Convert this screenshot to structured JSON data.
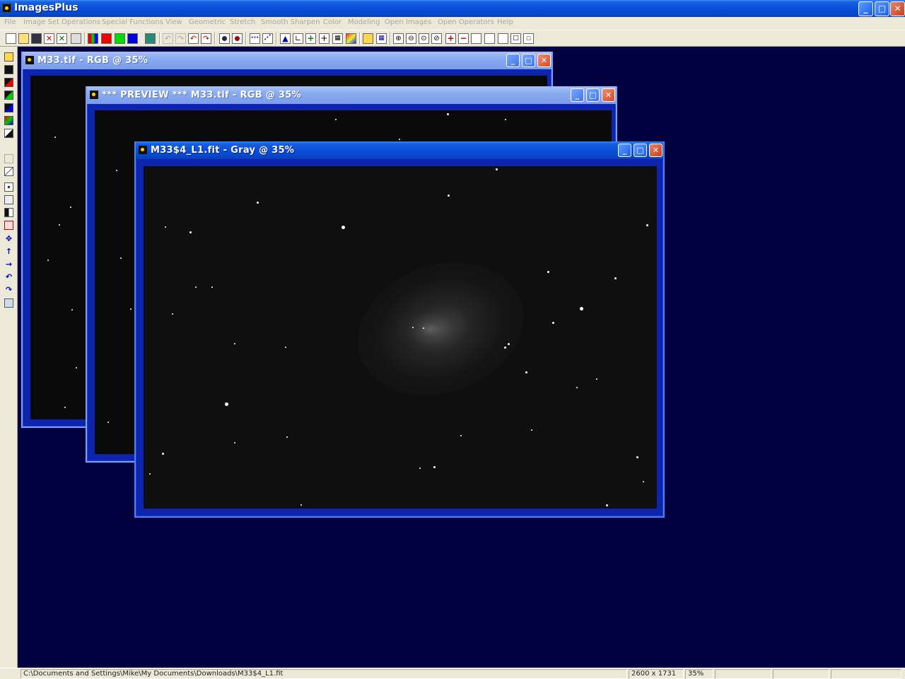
{
  "app": {
    "title": "ImagesPlus",
    "minimize": "_",
    "maximize": "□",
    "close": "✕"
  },
  "menu": [
    "File",
    "Image Set Operations",
    "Special Functions",
    "View",
    "Geometric",
    "Stretch",
    "Smooth Sharpen",
    "Color",
    "Modeling",
    "Open Images",
    "Open Operators",
    "Help"
  ],
  "windows": {
    "back": {
      "title": "M33.tif - RGB @ 35%"
    },
    "preview": {
      "title": "*** PREVIEW *** M33.tif - RGB @ 35%"
    },
    "front": {
      "title": "M33$4_L1.fit - Gray @ 35%"
    }
  },
  "status": {
    "path": "C:\\Documents and Settings\\Mike\\My Documents\\Downloads\\M33$4_L1.fit",
    "dimensions": "2600 x 1731",
    "zoom": "35%"
  },
  "colors": {
    "desktop": "#000040",
    "window_frame": "#0d25ae",
    "title_active": "#0a4fd8"
  },
  "icons": {
    "toolbar": [
      "new-icon",
      "open-icon",
      "save-icon",
      "close-image-icon",
      "close-all-icon",
      "print-icon",
      "rgb-channels-icon",
      "red-channel-icon",
      "green-channel-icon",
      "blue-channel-icon",
      "histogram-icon",
      "undo-icon",
      "redo-icon",
      "undo-all-icon",
      "redo-all-icon",
      "color-pick-icon",
      "color-pick-alt-icon",
      "line-profile-icon",
      "star-profile-icon",
      "triangle-icon",
      "measure-icon",
      "cross-icon",
      "crosshair-icon",
      "grid-icon",
      "palette-icon",
      "pencil-icon",
      "selection-icon",
      "zoom-in-icon",
      "zoom-out-icon",
      "zoom-fit-icon",
      "zoom-1to1-icon",
      "add-icon",
      "subtract-icon",
      "rect-select-icon",
      "rect-select-2-icon",
      "rect-select-3-icon",
      "point-icon",
      "small-point-icon"
    ]
  }
}
